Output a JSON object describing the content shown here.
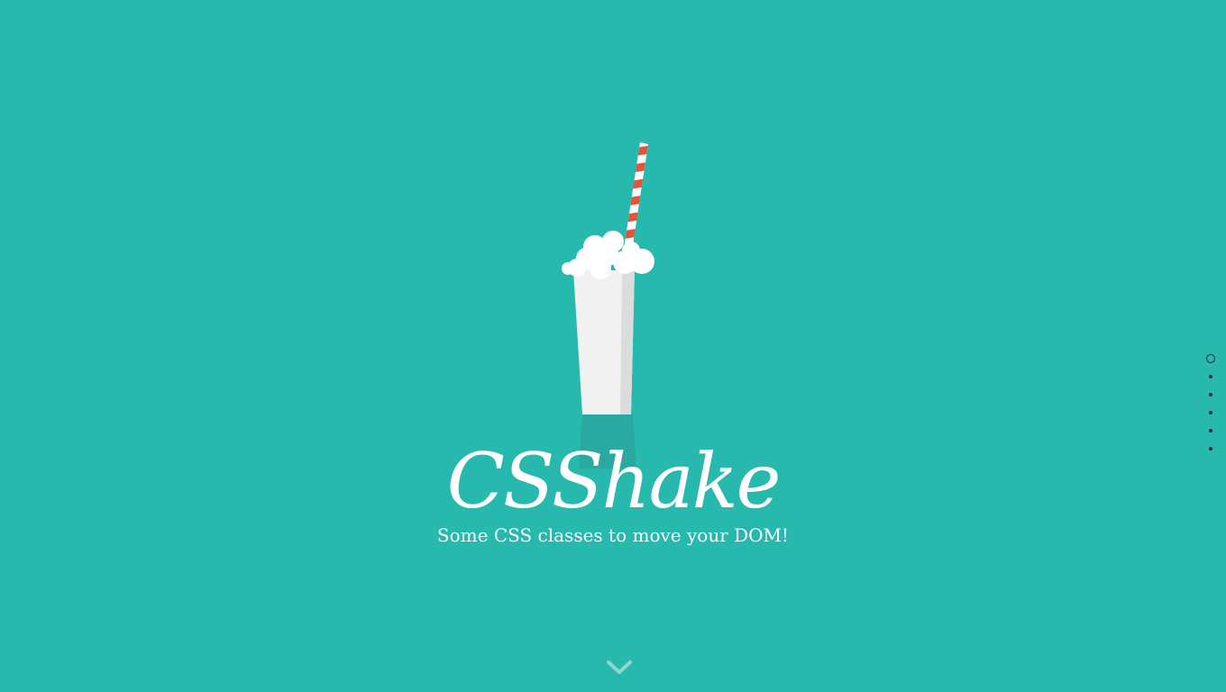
{
  "colors": {
    "background": "#27b8ae",
    "text": "#ffffff",
    "glass": "#f1f1f1",
    "glass_shade": "#dcdcdc",
    "glass_base": "#2aa9a1",
    "foam": "#ffffff",
    "straw_red": "#e2553b",
    "straw_white": "#ffffff",
    "nav_dot": "#1b2b2a",
    "chevron": "#8fd5d0"
  },
  "hero": {
    "title": "CSShake",
    "tagline": "Some CSS classes to move your DOM!"
  },
  "illustration": {
    "icon": "milkshake-glass-icon"
  },
  "scroll_hint": {
    "icon": "chevron-down-icon"
  },
  "section_nav": {
    "active_index": 0,
    "dots": [
      "section-1",
      "section-2",
      "section-3",
      "section-4",
      "section-5",
      "section-6"
    ]
  }
}
